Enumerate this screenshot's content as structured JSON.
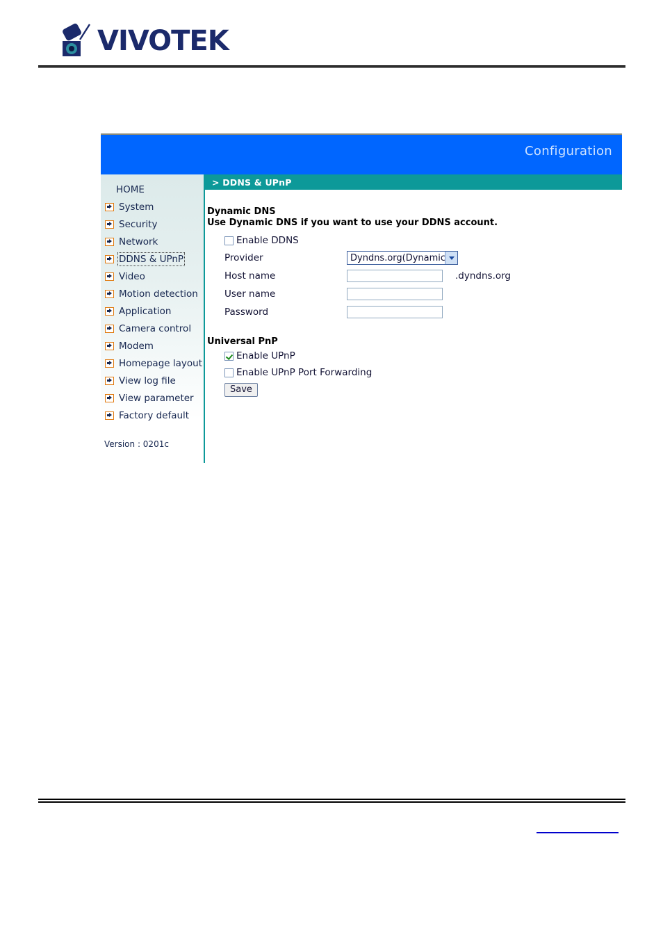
{
  "brand": {
    "logo_text": "VIVOTEK",
    "logo_icon": "camera-icon"
  },
  "panel": {
    "title": "Configuration",
    "section_label": "> DDNS & UPnP"
  },
  "sidebar": {
    "items": [
      {
        "label": "HOME",
        "has_arrow": false,
        "selected": false
      },
      {
        "label": "System",
        "has_arrow": true,
        "selected": false
      },
      {
        "label": "Security",
        "has_arrow": true,
        "selected": false
      },
      {
        "label": "Network",
        "has_arrow": true,
        "selected": false
      },
      {
        "label": "DDNS & UPnP",
        "has_arrow": true,
        "selected": true
      },
      {
        "label": "Video",
        "has_arrow": true,
        "selected": false
      },
      {
        "label": "Motion detection",
        "has_arrow": true,
        "selected": false
      },
      {
        "label": "Application",
        "has_arrow": true,
        "selected": false
      },
      {
        "label": "Camera control",
        "has_arrow": true,
        "selected": false
      },
      {
        "label": "Modem",
        "has_arrow": true,
        "selected": false
      },
      {
        "label": "Homepage layout",
        "has_arrow": true,
        "selected": false
      },
      {
        "label": "View log file",
        "has_arrow": true,
        "selected": false
      },
      {
        "label": "View parameter",
        "has_arrow": true,
        "selected": false
      },
      {
        "label": "Factory default",
        "has_arrow": true,
        "selected": false
      }
    ],
    "version": "Version : 0201c"
  },
  "dynamic_dns": {
    "heading": "Dynamic DNS",
    "subheading": "Use Dynamic DNS if you want to use your DDNS account.",
    "enable_label": "Enable DDNS",
    "enable_checked": false,
    "provider_label": "Provider",
    "provider_value": "Dyndns.org(Dynamic)",
    "provider_options": [
      "Dyndns.org(Dynamic)"
    ],
    "hostname_label": "Host name",
    "hostname_value": "",
    "hostname_suffix": ".dyndns.org",
    "username_label": "User name",
    "username_value": "",
    "password_label": "Password",
    "password_value": ""
  },
  "upnp": {
    "heading": "Universal PnP",
    "enable_label": "Enable UPnP",
    "enable_checked": true,
    "port_forwarding_label": "Enable UPnP Port Forwarding",
    "port_forwarding_checked": false,
    "save_label": "Save"
  },
  "colors": {
    "header_blue": "#0066ff",
    "section_teal": "#0d9999",
    "sidebar_top": "#dceaea",
    "arrow_orange": "#e07a10",
    "nav_text": "#16264f",
    "link_blue": "#0000cc"
  }
}
